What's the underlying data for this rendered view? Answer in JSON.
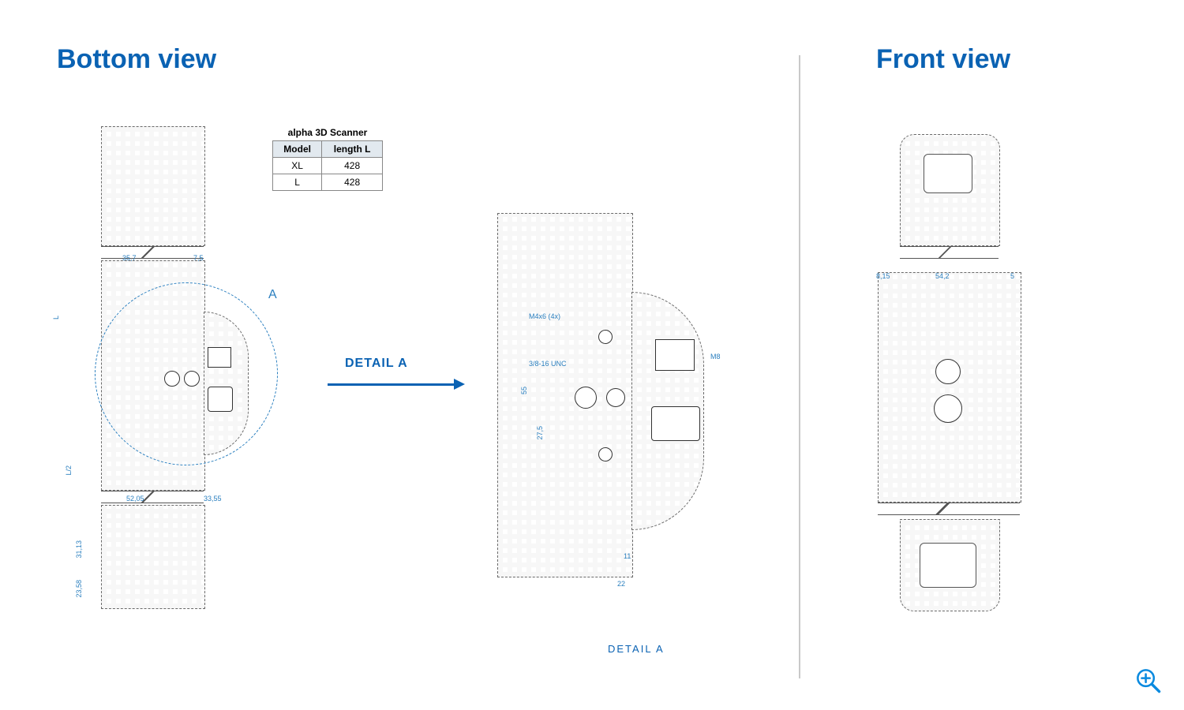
{
  "views": {
    "bottom": {
      "title": "Bottom view"
    },
    "front": {
      "title": "Front view"
    }
  },
  "table": {
    "caption": "alpha 3D Scanner",
    "headers": {
      "model": "Model",
      "length": "length L"
    },
    "rows": [
      {
        "model": "XL",
        "length": "428"
      },
      {
        "model": "L",
        "length": "428"
      }
    ]
  },
  "detail": {
    "callout_label": "DETAIL A",
    "circle_letter": "A",
    "caption": "DETAIL A"
  },
  "dimensions": {
    "bottom": {
      "overall_length_label": "L",
      "half_label": "L/2",
      "d_3113": "31,13",
      "d_2358": "23,58",
      "d_5205": "52,05",
      "d_3355": "33,55",
      "d_357": "35,7",
      "d_75": "7,5"
    },
    "detailA": {
      "thread1": "M4x6  (4x)",
      "thread2": "3/8-16 UNC",
      "conn": "M8",
      "d_55": "55",
      "d_275": "27,5",
      "d_11": "11",
      "d_22": "22"
    },
    "front": {
      "d_815": "8,15",
      "d_542": "54,2",
      "d_5": "5"
    }
  },
  "icons": {
    "zoom": "zoom-in-icon"
  }
}
